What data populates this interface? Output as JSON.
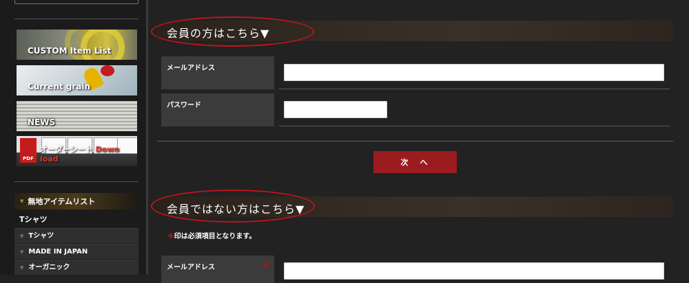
{
  "sidebar": {
    "banners": [
      {
        "label": "CUSTOM Item List"
      },
      {
        "label": "Current grain"
      },
      {
        "label": "NEWS"
      },
      {
        "label": "オーダーシート",
        "label_suffix": "Down load",
        "pdf_badge": "PDF"
      }
    ],
    "menu_header": "無地アイテムリスト",
    "menu_plain_item": "Tシャツ",
    "menu_sub_items": [
      "Tシャツ",
      "MADE IN JAPAN",
      "オーガニック"
    ]
  },
  "member_section": {
    "title": "会員の方はこちら▼",
    "email_label": "メールアドレス",
    "password_label": "パスワード",
    "email_value": "",
    "password_value": "",
    "next_button": "次　へ"
  },
  "nonmember_section": {
    "title": "会員ではない方はこちら▼",
    "required_note_mark": "※",
    "required_note_text": "印は必須項目となります。",
    "email_label": "メールアドレス",
    "required_mark": "※",
    "email_value": ""
  },
  "colors": {
    "background": "#222222",
    "accent_red": "#9b1c20",
    "highlight_ellipse": "#c0141a"
  }
}
